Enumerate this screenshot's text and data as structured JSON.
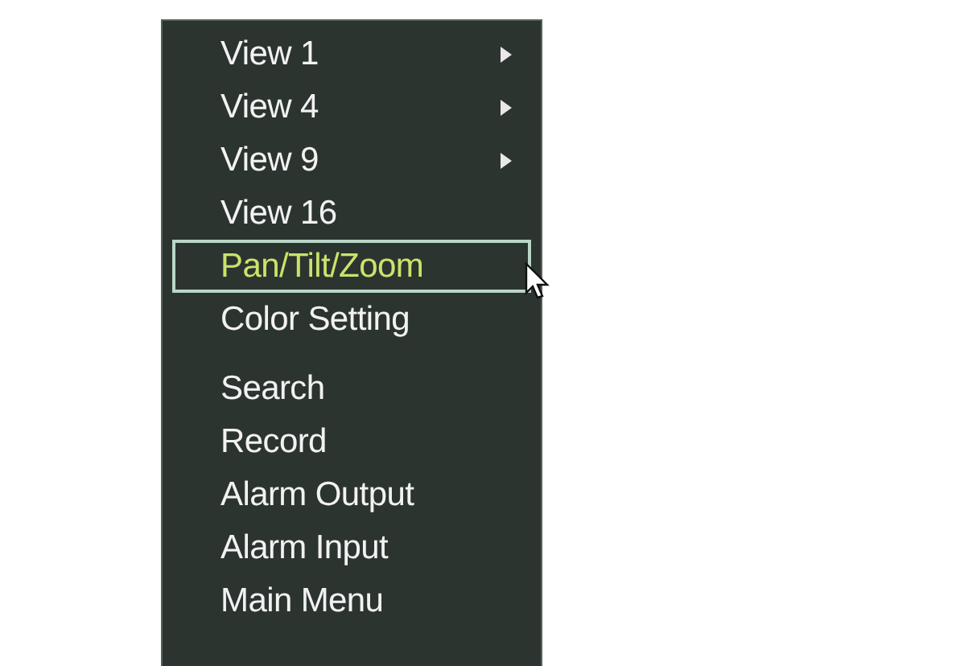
{
  "menu": {
    "groups": [
      {
        "items": [
          {
            "label": "View 1",
            "submenu": true,
            "selected": false
          },
          {
            "label": "View 4",
            "submenu": true,
            "selected": false
          },
          {
            "label": "View 9",
            "submenu": true,
            "selected": false
          },
          {
            "label": "View 16",
            "submenu": false,
            "selected": false
          },
          {
            "label": "Pan/Tilt/Zoom",
            "submenu": false,
            "selected": true
          },
          {
            "label": "Color Setting",
            "submenu": false,
            "selected": false
          }
        ]
      },
      {
        "items": [
          {
            "label": "Search",
            "submenu": false,
            "selected": false
          },
          {
            "label": "Record",
            "submenu": false,
            "selected": false
          },
          {
            "label": "Alarm Output",
            "submenu": false,
            "selected": false
          },
          {
            "label": "Alarm Input",
            "submenu": false,
            "selected": false
          },
          {
            "label": "Main Menu",
            "submenu": false,
            "selected": false
          }
        ]
      }
    ]
  }
}
